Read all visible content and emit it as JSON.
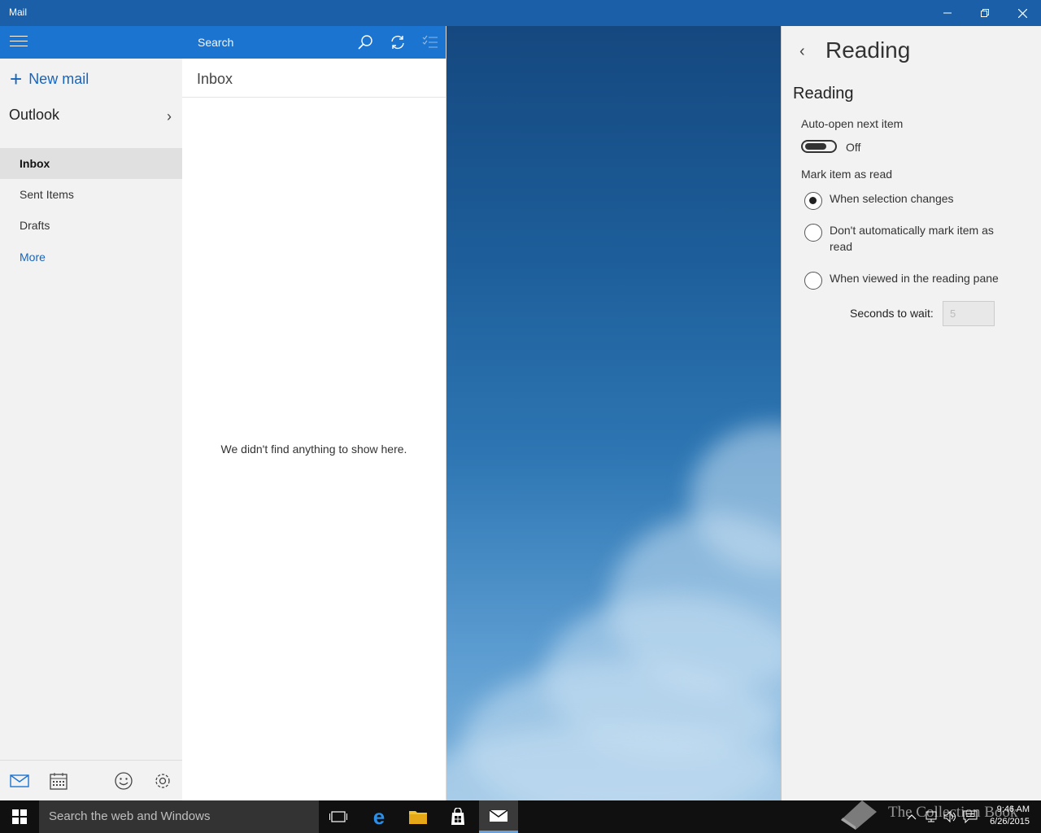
{
  "window": {
    "title": "Mail",
    "controls": {
      "minimize": "minimize-icon",
      "restore": "restore-icon",
      "close": "close-icon"
    }
  },
  "nav": {
    "new_mail_label": "New mail",
    "account_name": "Outlook",
    "folders": [
      {
        "label": "Inbox",
        "selected": true
      },
      {
        "label": "Sent Items"
      },
      {
        "label": "Drafts"
      },
      {
        "label": "More"
      }
    ],
    "footer_icons": [
      "mail-icon",
      "calendar-icon",
      "feedback-smiley-icon",
      "settings-gear-icon"
    ]
  },
  "message_list": {
    "search_placeholder": "Search",
    "folder_title": "Inbox",
    "empty_message": "We didn't find anything to show here."
  },
  "settings_pane": {
    "title": "Reading",
    "section_title": "Reading",
    "auto_open": {
      "label": "Auto-open next item",
      "state": "Off"
    },
    "mark_as_read": {
      "label": "Mark item as read",
      "options": [
        {
          "label": "When selection changes",
          "checked": true
        },
        {
          "label": "Don't automatically mark item as read",
          "checked": false
        },
        {
          "label": "When viewed in the reading pane",
          "checked": false
        }
      ],
      "seconds_label": "Seconds to wait:",
      "seconds_value": "5"
    }
  },
  "taskbar": {
    "search_placeholder": "Search the web and Windows",
    "apps": [
      "task-view-icon",
      "edge-icon",
      "file-explorer-icon",
      "store-icon",
      "mail-icon"
    ],
    "clock_time": "9:46 AM",
    "clock_date": "6/26/2015"
  },
  "watermark": {
    "text": "The Collection Book"
  },
  "colors": {
    "accent": "#1c74d1",
    "titlebar": "#1a5fa8",
    "link": "#1565c0",
    "pane_bg": "#f2f2f2",
    "taskbar": "#101010"
  }
}
